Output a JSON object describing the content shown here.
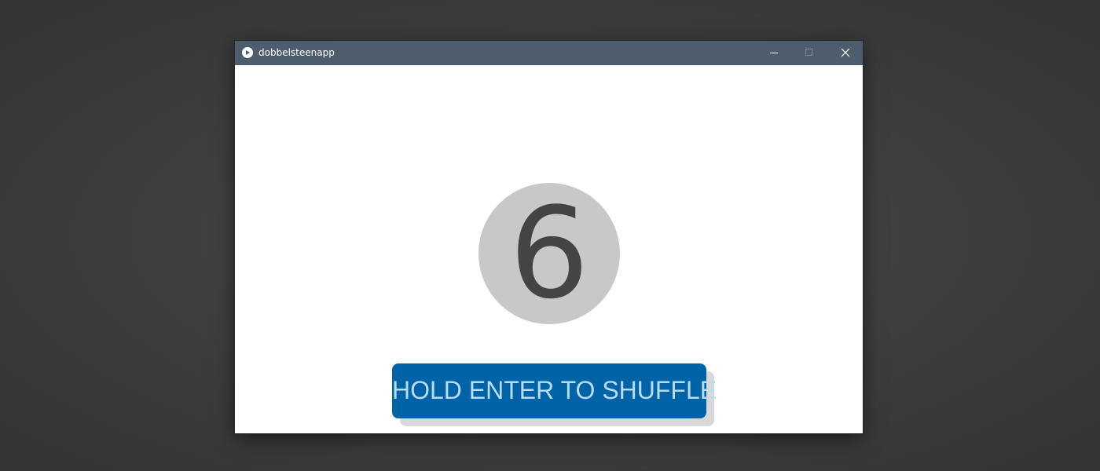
{
  "window": {
    "title": "dobbelsteenapp",
    "app_icon": "play-circle-icon",
    "controls": {
      "minimize": "minimize-icon",
      "maximize": "maximize-icon",
      "close": "close-icon"
    }
  },
  "die": {
    "value": "6"
  },
  "shuffle_button": {
    "label": "HOLD ENTER TO SHUFFLE"
  },
  "colors": {
    "titlebar": "#4e5d6d",
    "button_background": "#0063a8",
    "button_text": "#b9dcf3",
    "die_circle": "#c8c8c8",
    "die_text": "#444444",
    "desktop": "#3d3d3d"
  }
}
